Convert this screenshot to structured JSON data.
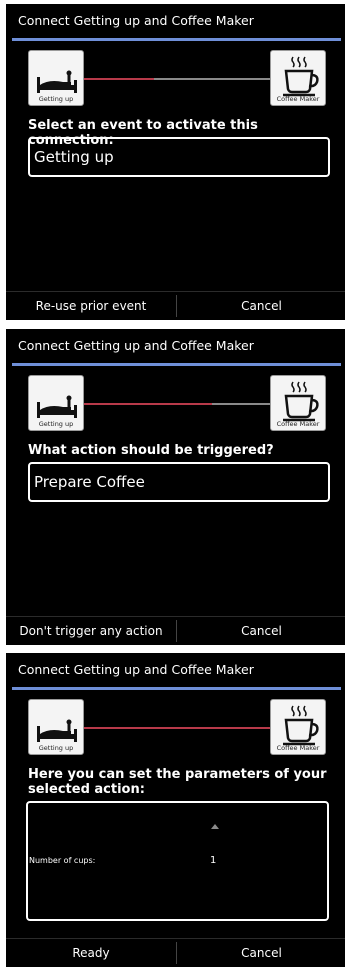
{
  "panels": [
    {
      "title": "Connect Getting up and Coffee Maker",
      "source_icon": {
        "name": "bed-icon",
        "label": "Getting up"
      },
      "target_icon": {
        "name": "coffee-cup-icon",
        "label": "Coffee Maker"
      },
      "prompt": "Select an event to activate this connection:",
      "choice": "Getting up",
      "buttons": {
        "left": "Re-use prior event",
        "right": "Cancel"
      }
    },
    {
      "title": "Connect Getting up and Coffee Maker",
      "source_icon": {
        "name": "bed-icon",
        "label": "Getting up"
      },
      "target_icon": {
        "name": "coffee-cup-icon",
        "label": "Coffee Maker"
      },
      "prompt": "What action should be triggered?",
      "choice": "Prepare Coffee",
      "buttons": {
        "left": "Don't trigger any action",
        "right": "Cancel"
      }
    },
    {
      "title": "Connect Getting up and Coffee Maker",
      "source_icon": {
        "name": "bed-icon",
        "label": "Getting up"
      },
      "target_icon": {
        "name": "coffee-cup-icon",
        "label": "Coffee Maker"
      },
      "prompt": "Here you can set the parameters of your selected action:",
      "parameter": {
        "label": "Number of cups:",
        "value": "1"
      },
      "buttons": {
        "left": "Ready",
        "right": "Cancel"
      }
    }
  ],
  "colors": {
    "title_rule": "#6f8fd8",
    "link_active": "#b83a4a",
    "link_inactive": "#8a8a8a",
    "background": "#000000"
  }
}
